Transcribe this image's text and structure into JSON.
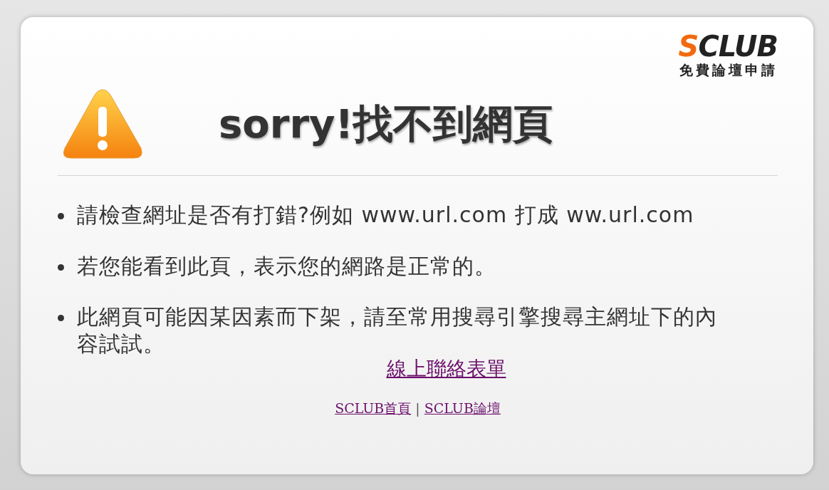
{
  "logo": {
    "accent": "S",
    "name": "CLUB",
    "tagline": "免費論壇申請"
  },
  "title": "sorry!找不到網頁",
  "tips": [
    {
      "text": "請檢查網址是否有打錯?例如 www.url.com 打成 ww.url.com"
    },
    {
      "text": "若您能看到此頁，表示您的網路是正常的。"
    },
    {
      "text": "此網頁可能因某因素而下架，請至常用搜尋引擎搜尋主網址下的內容試試。"
    }
  ],
  "contact_link": "線上聯絡表單",
  "footer_links": [
    "SCLUB首頁",
    "SCLUB論壇"
  ],
  "footer_separator": "|"
}
